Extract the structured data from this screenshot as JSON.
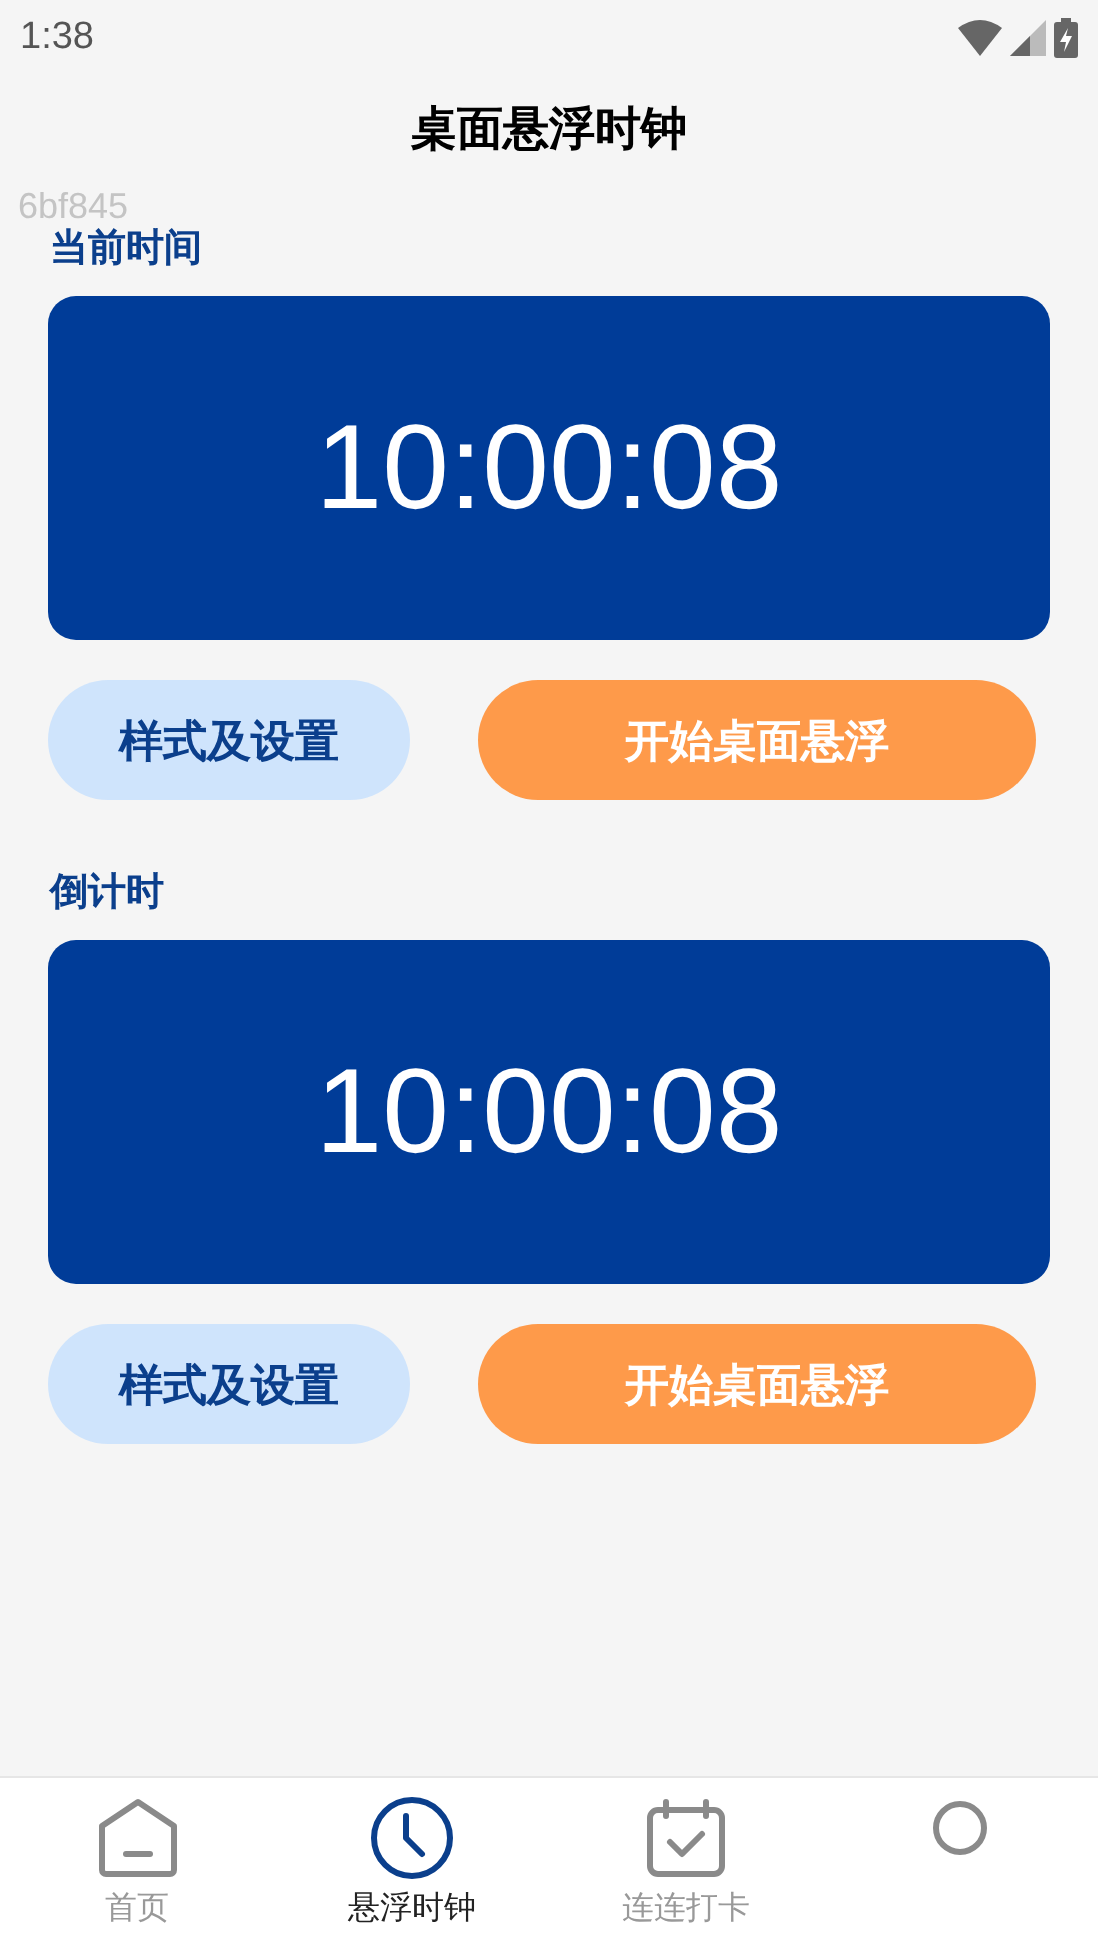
{
  "status_bar": {
    "time": "1:38"
  },
  "title": "桌面悬浮时钟",
  "debug_label": "6bf845",
  "sections": [
    {
      "label": "当前时间",
      "time": "10:00:08",
      "buttons": {
        "settings": "样式及设置",
        "start": "开始桌面悬浮"
      }
    },
    {
      "label": "倒计时",
      "time": "10:00:08",
      "buttons": {
        "settings": "样式及设置",
        "start": "开始桌面悬浮"
      }
    }
  ],
  "bottom_nav": [
    {
      "kind": "home",
      "label": "首页",
      "selected": false
    },
    {
      "kind": "clock",
      "label": "悬浮时钟",
      "selected": true
    },
    {
      "kind": "calendar",
      "label": "连连打卡",
      "selected": false
    },
    {
      "kind": "circle",
      "selected": false
    }
  ]
}
